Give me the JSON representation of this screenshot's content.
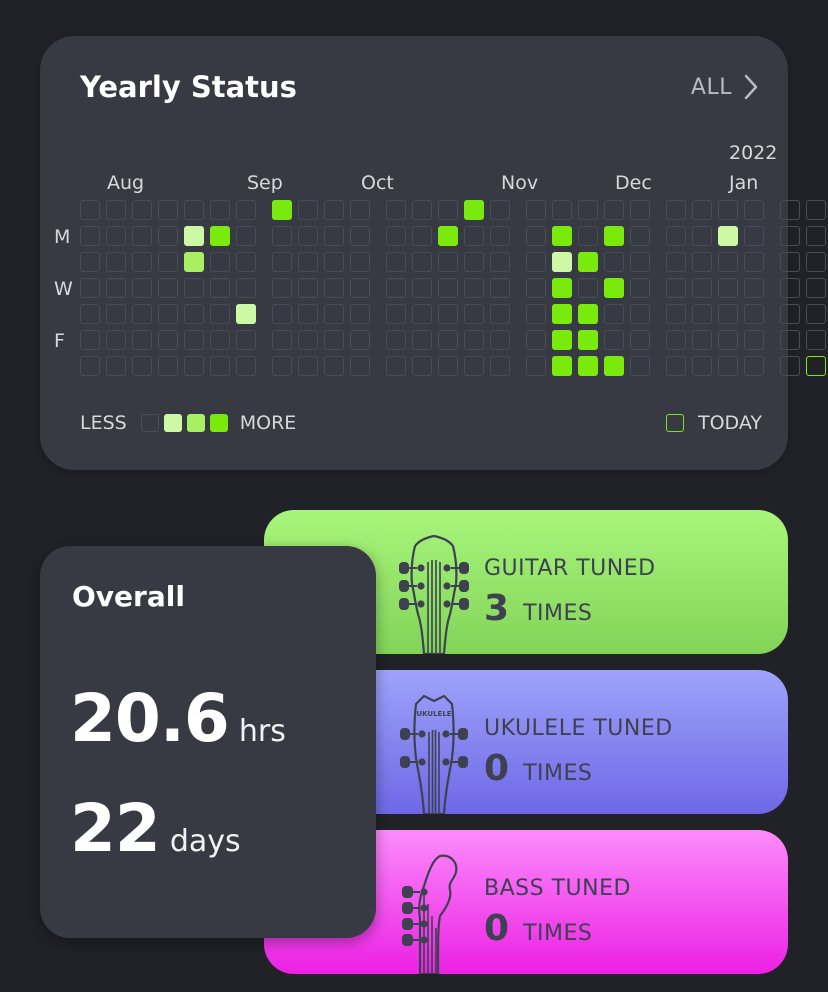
{
  "yearly": {
    "title": "Yearly Status",
    "all_label": "ALL",
    "year_label": "2022",
    "months": [
      "Aug",
      "Sep",
      "Oct",
      "Nov",
      "Dec",
      "Jan"
    ],
    "day_labels": [
      "M",
      "W",
      "F"
    ],
    "grid": {
      "columns": 27,
      "rows": 7,
      "active_cells": [
        {
          "col": 4,
          "row": 1,
          "level": 1
        },
        {
          "col": 4,
          "row": 2,
          "level": 2
        },
        {
          "col": 5,
          "row": 1,
          "level": 3
        },
        {
          "col": 6,
          "row": 4,
          "level": 1
        },
        {
          "col": 7,
          "row": 0,
          "level": 3
        },
        {
          "col": 13,
          "row": 1,
          "level": 3
        },
        {
          "col": 14,
          "row": 0,
          "level": 3
        },
        {
          "col": 17,
          "row": 1,
          "level": 3
        },
        {
          "col": 17,
          "row": 2,
          "level": 1
        },
        {
          "col": 17,
          "row": 3,
          "level": 3
        },
        {
          "col": 17,
          "row": 4,
          "level": 3
        },
        {
          "col": 17,
          "row": 5,
          "level": 3
        },
        {
          "col": 17,
          "row": 6,
          "level": 3
        },
        {
          "col": 18,
          "row": 2,
          "level": 3
        },
        {
          "col": 18,
          "row": 4,
          "level": 3
        },
        {
          "col": 18,
          "row": 5,
          "level": 3
        },
        {
          "col": 18,
          "row": 6,
          "level": 3
        },
        {
          "col": 19,
          "row": 1,
          "level": 3
        },
        {
          "col": 19,
          "row": 3,
          "level": 3
        },
        {
          "col": 19,
          "row": 6,
          "level": 3
        },
        {
          "col": 23,
          "row": 1,
          "level": 1
        }
      ],
      "today": {
        "col": 26,
        "row": 6
      }
    },
    "legend": {
      "less": "LESS",
      "more": "MORE",
      "today": "TODAY"
    }
  },
  "instruments": [
    {
      "label": "GUITAR TUNED",
      "count": "3",
      "unit": "TIMES",
      "icon": "guitar-headstock-icon"
    },
    {
      "label": "UKULELE TUNED",
      "count": "0",
      "unit": "TIMES",
      "icon": "ukulele-headstock-icon",
      "icon_text": "UKULELE"
    },
    {
      "label": "BASS TUNED",
      "count": "0",
      "unit": "TIMES",
      "icon": "bass-headstock-icon"
    }
  ],
  "overall": {
    "title": "Overall",
    "hours": "20.6",
    "hours_unit": "hrs",
    "days": "22",
    "days_unit": "days"
  },
  "colors": {
    "level_1": "#cdf9a4",
    "level_2": "#a8f061",
    "level_3": "#79ea0c",
    "empty_cell_border": "#4a4d55",
    "guitar_card": "#98e86c",
    "ukulele_card": "#8a89f2",
    "bass_card": "#f45af0"
  }
}
